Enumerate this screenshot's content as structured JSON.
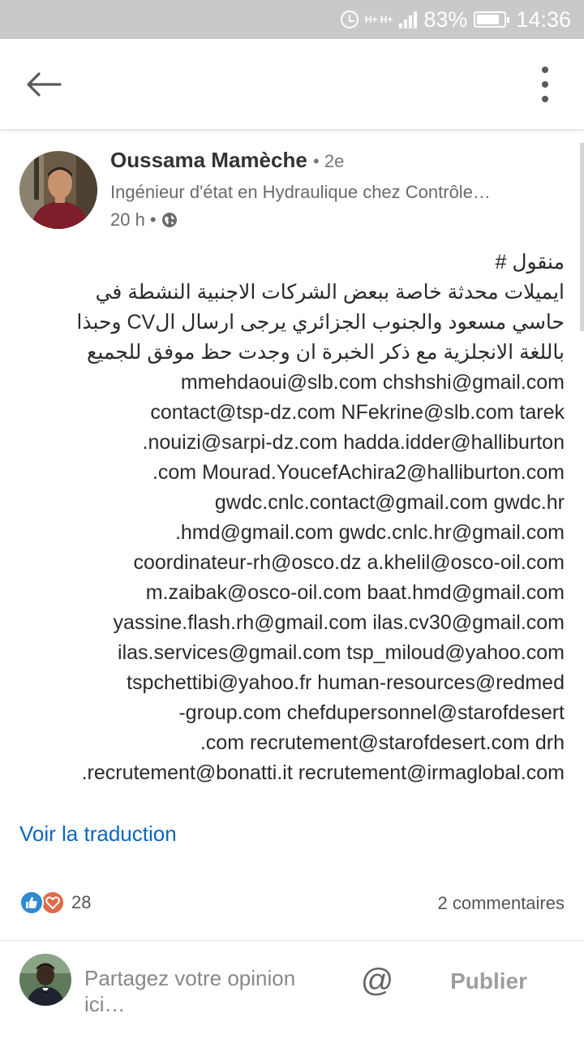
{
  "status_bar": {
    "network_label": "H+ H+",
    "battery_percent": "83%",
    "battery_level": 0.83,
    "time": "14:36",
    "icons": [
      "alarm-icon",
      "signal-icon",
      "battery-icon"
    ]
  },
  "app_bar": {
    "icons": [
      "arrow-left-icon",
      "more-vertical-icon"
    ]
  },
  "post": {
    "author_name": "Oussama Mamèche",
    "connection": "• 2e",
    "headline": "Ingénieur d'état en Hydraulique chez Contrôle…",
    "time_ago": "20 h •",
    "visibility_icon": "globe-icon",
    "lines": [
      "منقول #",
      "ايميلات محدثة خاصة ببعض الشركات الاجنبية النشطة في",
      "حاسي مسعود والجنوب الجزائري يرجى ارسال الCV وحبذا",
      "باللغة الانجلزية مع ذكر الخبرة ان وجدت حظ موفق للجميع",
      "mmehdaoui@slb.com chshshi@gmail.com",
      "contact@tsp-dz.com NFekrine@slb.com tarek",
      ".nouizi@sarpi-dz.com hadda.idder@halliburton",
      ".com Mourad.YoucefAchira2@halliburton.com",
      "gwdc.cnlc.contact@gmail.com gwdc.hr",
      ".hmd@gmail.com gwdc.cnlc.hr@gmail.com",
      "coordinateur-rh@osco.dz a.khelil@osco-oil.com",
      "m.zaibak@osco-oil.com baat.hmd@gmail.com",
      "yassine.flash.rh@gmail.com ilas.cv30@gmail.com",
      "ilas.services@gmail.com tsp_miloud@yahoo.com",
      "tspchettibi@yahoo.fr human-resources@redmed",
      "-group.com chefdupersonnel@starofdesert",
      ".com recrutement@starofdesert.com drh",
      ".recrutement@bonatti.it recrutement@irmaglobal.com"
    ],
    "translate_label": "Voir la traduction",
    "reaction_count": "28",
    "reaction_icons": [
      "thumbs-up-icon",
      "heart-icon"
    ],
    "comments_label": "2 commentaires"
  },
  "composer": {
    "placeholder": "Partagez votre opinion ici…",
    "mention_symbol": "@",
    "publish_label": "Publier"
  },
  "colors": {
    "status_bar_bg": "#c9c9c9",
    "link_blue": "#0a66c2",
    "like_blue": "#2d8ad3",
    "love_orange": "#e06a4a"
  }
}
